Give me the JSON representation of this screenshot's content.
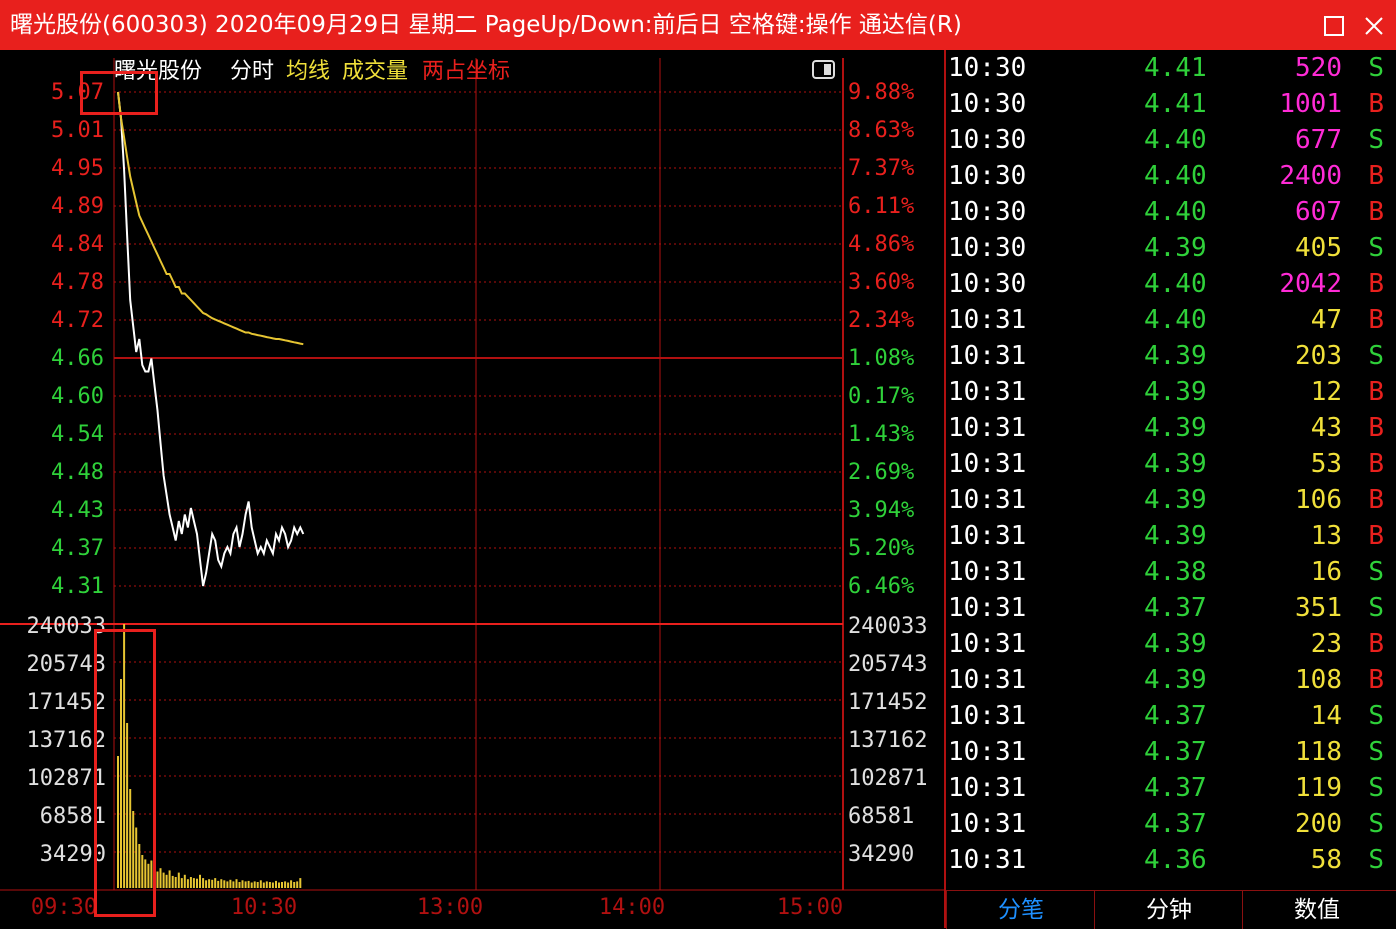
{
  "window": {
    "title": "曙光股份(600303) 2020年09月29日 星期二 PageUp/Down:前后日 空格键:操作 通达信(R)",
    "maximize_icon": "maximize-icon",
    "close_icon": "close-icon"
  },
  "chart_header": {
    "stock_name": "曙光股份",
    "mode": "分时",
    "avg_label": "均线",
    "volume_label": "成交量",
    "dual_axis_label": "两占坐标"
  },
  "colors": {
    "up": "#e8201d",
    "down": "#2fd13a",
    "price_line": "#ffffff",
    "avg_line": "#e6c532",
    "volume": "#e6c532",
    "grid": "#b01010",
    "magenta": "#ff2bd6",
    "yellow": "#f0e03a",
    "tab_active": "#1e90ff"
  },
  "chart_data": [
    {
      "type": "line",
      "name": "intraday-price",
      "price_ticks": [
        "5.07",
        "5.01",
        "4.95",
        "4.89",
        "4.84",
        "4.78",
        "4.72",
        "4.66",
        "4.60",
        "4.54",
        "4.48",
        "4.43",
        "4.37",
        "4.31"
      ],
      "pct_ticks": [
        "9.88%",
        "8.63%",
        "7.37%",
        "6.11%",
        "4.86%",
        "3.60%",
        "2.34%",
        "1.08%",
        "0.17%",
        "1.43%",
        "2.69%",
        "3.94%",
        "5.20%",
        "6.46%"
      ],
      "ylim": [
        4.31,
        5.07
      ],
      "prev_close": 4.612,
      "x_ticks": [
        "09:30",
        "10:30",
        "13:00",
        "14:00",
        "15:00"
      ],
      "x_minutes": [
        0,
        1,
        2,
        3,
        4,
        5,
        6,
        7,
        8,
        9,
        10,
        11,
        12,
        13,
        14,
        15,
        16,
        17,
        18,
        19,
        20,
        21,
        22,
        23,
        24,
        25,
        26,
        27,
        28,
        29,
        30,
        31,
        32,
        33,
        34,
        35,
        36,
        37,
        38,
        39,
        40,
        41,
        42,
        43,
        44,
        45,
        46,
        47,
        48,
        49,
        50,
        51,
        52,
        53,
        54,
        55,
        56,
        57,
        58,
        59,
        60,
        61
      ],
      "price": [
        5.07,
        5.03,
        4.95,
        4.85,
        4.75,
        4.71,
        4.67,
        4.69,
        4.65,
        4.64,
        4.64,
        4.66,
        4.62,
        4.58,
        4.53,
        4.48,
        4.45,
        4.42,
        4.4,
        4.38,
        4.41,
        4.39,
        4.42,
        4.4,
        4.43,
        4.41,
        4.39,
        4.35,
        4.31,
        4.33,
        4.36,
        4.39,
        4.38,
        4.35,
        4.34,
        4.36,
        4.37,
        4.36,
        4.39,
        4.4,
        4.37,
        4.39,
        4.42,
        4.44,
        4.4,
        4.38,
        4.36,
        4.37,
        4.36,
        4.38,
        4.37,
        4.36,
        4.39,
        4.38,
        4.4,
        4.39,
        4.37,
        4.38,
        4.4,
        4.39,
        4.4,
        4.39
      ],
      "avg": [
        5.07,
        5.03,
        5.0,
        4.97,
        4.94,
        4.92,
        4.9,
        4.88,
        4.87,
        4.86,
        4.85,
        4.84,
        4.83,
        4.82,
        4.81,
        4.8,
        4.79,
        4.79,
        4.78,
        4.77,
        4.77,
        4.76,
        4.76,
        4.755,
        4.75,
        4.745,
        4.74,
        4.735,
        4.73,
        4.728,
        4.725,
        4.722,
        4.72,
        4.718,
        4.716,
        4.714,
        4.712,
        4.71,
        4.708,
        4.706,
        4.704,
        4.702,
        4.7,
        4.7,
        4.698,
        4.697,
        4.696,
        4.695,
        4.694,
        4.693,
        4.692,
        4.691,
        4.69,
        4.69,
        4.689,
        4.688,
        4.687,
        4.686,
        4.685,
        4.684,
        4.683,
        4.682
      ]
    },
    {
      "type": "bar",
      "name": "intraday-volume",
      "vol_ticks_left": [
        "240033",
        "205743",
        "171452",
        "137162",
        "102871",
        "68581",
        "34290"
      ],
      "vol_ticks_right": [
        "240033",
        "205743",
        "171452",
        "137162",
        "102871",
        "68581",
        "34290"
      ],
      "ylim": [
        0,
        240033
      ],
      "values": [
        120000,
        190000,
        240000,
        150000,
        90000,
        70000,
        55000,
        40000,
        30000,
        26000,
        22000,
        25000,
        20000,
        15000,
        18000,
        14000,
        12000,
        16000,
        11000,
        10000,
        14000,
        9000,
        12000,
        8000,
        10000,
        9000,
        8500,
        12000,
        9000,
        7000,
        8000,
        7500,
        9000,
        6500,
        8000,
        7000,
        6000,
        7500,
        6000,
        8000,
        5500,
        7000,
        6000,
        6500,
        5000,
        6000,
        5500,
        7000,
        5000,
        6000,
        5500,
        5000,
        6500,
        5000,
        5500,
        6000,
        5000,
        7000,
        5500,
        6000,
        9000
      ]
    }
  ],
  "ticker": [
    {
      "time": "10:30",
      "price": "4.41",
      "vol": "520",
      "side": "S",
      "vc": "magenta"
    },
    {
      "time": "10:30",
      "price": "4.41",
      "vol": "1001",
      "side": "B",
      "vc": "magenta"
    },
    {
      "time": "10:30",
      "price": "4.40",
      "vol": "677",
      "side": "S",
      "vc": "magenta"
    },
    {
      "time": "10:30",
      "price": "4.40",
      "vol": "2400",
      "side": "B",
      "vc": "magenta"
    },
    {
      "time": "10:30",
      "price": "4.40",
      "vol": "607",
      "side": "B",
      "vc": "magenta"
    },
    {
      "time": "10:30",
      "price": "4.39",
      "vol": "405",
      "side": "S",
      "vc": "yellow"
    },
    {
      "time": "10:30",
      "price": "4.40",
      "vol": "2042",
      "side": "B",
      "vc": "magenta"
    },
    {
      "time": "10:31",
      "price": "4.40",
      "vol": "47",
      "side": "B",
      "vc": "yellow"
    },
    {
      "time": "10:31",
      "price": "4.39",
      "vol": "203",
      "side": "S",
      "vc": "yellow"
    },
    {
      "time": "10:31",
      "price": "4.39",
      "vol": "12",
      "side": "B",
      "vc": "yellow"
    },
    {
      "time": "10:31",
      "price": "4.39",
      "vol": "43",
      "side": "B",
      "vc": "yellow"
    },
    {
      "time": "10:31",
      "price": "4.39",
      "vol": "53",
      "side": "B",
      "vc": "yellow"
    },
    {
      "time": "10:31",
      "price": "4.39",
      "vol": "106",
      "side": "B",
      "vc": "yellow"
    },
    {
      "time": "10:31",
      "price": "4.39",
      "vol": "13",
      "side": "B",
      "vc": "yellow"
    },
    {
      "time": "10:31",
      "price": "4.38",
      "vol": "16",
      "side": "S",
      "vc": "yellow"
    },
    {
      "time": "10:31",
      "price": "4.37",
      "vol": "351",
      "side": "S",
      "vc": "yellow"
    },
    {
      "time": "10:31",
      "price": "4.39",
      "vol": "23",
      "side": "B",
      "vc": "yellow"
    },
    {
      "time": "10:31",
      "price": "4.39",
      "vol": "108",
      "side": "B",
      "vc": "yellow"
    },
    {
      "time": "10:31",
      "price": "4.37",
      "vol": "14",
      "side": "S",
      "vc": "yellow"
    },
    {
      "time": "10:31",
      "price": "4.37",
      "vol": "118",
      "side": "S",
      "vc": "yellow"
    },
    {
      "time": "10:31",
      "price": "4.37",
      "vol": "119",
      "side": "S",
      "vc": "yellow"
    },
    {
      "time": "10:31",
      "price": "4.37",
      "vol": "200",
      "side": "S",
      "vc": "yellow"
    },
    {
      "time": "10:31",
      "price": "4.36",
      "vol": "58",
      "side": "S",
      "vc": "yellow"
    }
  ],
  "tabs": [
    {
      "label": "分笔",
      "active": true
    },
    {
      "label": "分钟",
      "active": false
    },
    {
      "label": "数值",
      "active": false
    }
  ]
}
